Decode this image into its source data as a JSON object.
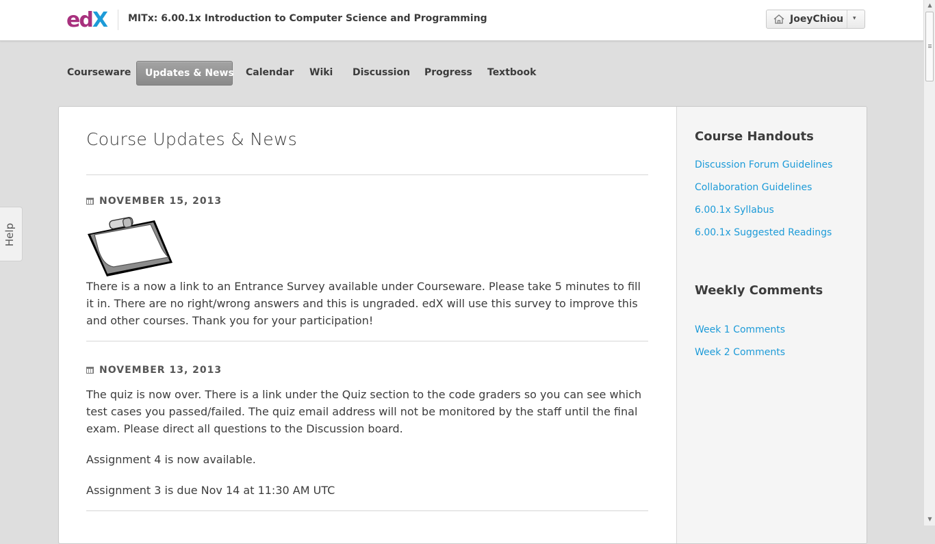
{
  "header": {
    "logo_text": "edX",
    "course_title": "MITx: 6.00.1x Introduction to Computer Science and Programming",
    "username": "JoeyChiou",
    "user_caret": "▾"
  },
  "tabs": [
    {
      "label": "Courseware"
    },
    {
      "label": "Updates & News",
      "active": true
    },
    {
      "label": "Calendar"
    },
    {
      "label": "Wiki"
    },
    {
      "label": "Discussion"
    },
    {
      "label": "Progress"
    },
    {
      "label": "Textbook"
    }
  ],
  "main": {
    "title": "Course Updates & News",
    "updates": [
      {
        "date": "NOVEMBER 15, 2013",
        "paragraphs": [
          "There is a now a link to an Entrance Survey available under Courseware. Please take 5 minutes to fill it in. There are no right/wrong answers and this is ungraded. edX will use this survey to improve this and other courses. Thank you for your participation!"
        ]
      },
      {
        "date": "NOVEMBER 13, 2013",
        "paragraphs": [
          "The quiz is now over. There is a link under the Quiz section to the code graders so you can see which test cases you passed/failed. The quiz email address will not be monitored by the staff until the final exam. Please direct all questions to the Discussion board.",
          "Assignment 4 is now available.",
          "Assignment 3 is due Nov 14 at 11:30 AM UTC"
        ]
      }
    ]
  },
  "sidebar": {
    "handouts_title": "Course Handouts",
    "handouts": [
      "Discussion Forum Guidelines",
      "Collaboration Guidelines",
      "6.00.1x Syllabus",
      "6.00.1x Suggested Readings"
    ],
    "comments_title": "Weekly Comments",
    "comments": [
      "Week 1 Comments",
      "Week 2 Comments"
    ]
  },
  "help_tab": "Help",
  "colors": {
    "link": "#1d9bd8",
    "logo_magenta": "#a8317e",
    "logo_blue": "#1d9bd8",
    "active_tab": "#8f8f8f"
  }
}
